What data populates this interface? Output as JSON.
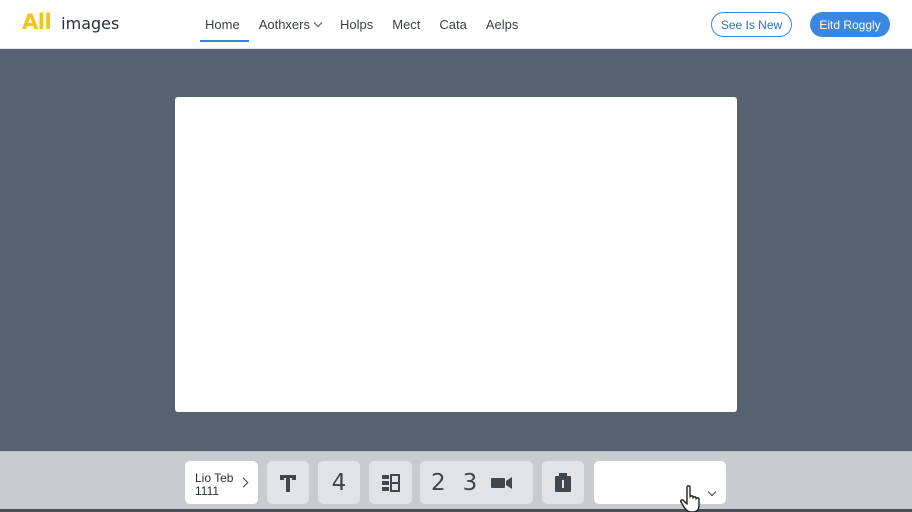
{
  "header": {
    "logo_mark": "All",
    "logo_text": "images",
    "nav": [
      {
        "label": "Home",
        "active": true
      },
      {
        "label": "Aothxers",
        "active": false
      },
      {
        "label": "Holps",
        "active": false
      },
      {
        "label": "Mect",
        "active": false
      },
      {
        "label": "Cata",
        "active": false
      },
      {
        "label": "Aelps",
        "active": false
      }
    ],
    "outline_button": "See Is New",
    "solid_button": "Eitd Roggly"
  },
  "toolbar": {
    "tab_line1": "Lio Teb",
    "tab_line2": "1111",
    "num_4": "4",
    "num_2": "2",
    "num_3": "3",
    "dropdown_value": ""
  },
  "colors": {
    "accent": "#3a86e0",
    "brand": "#f2c318",
    "workspace": "#576271",
    "toolbar_bg": "#c9cbcf"
  }
}
